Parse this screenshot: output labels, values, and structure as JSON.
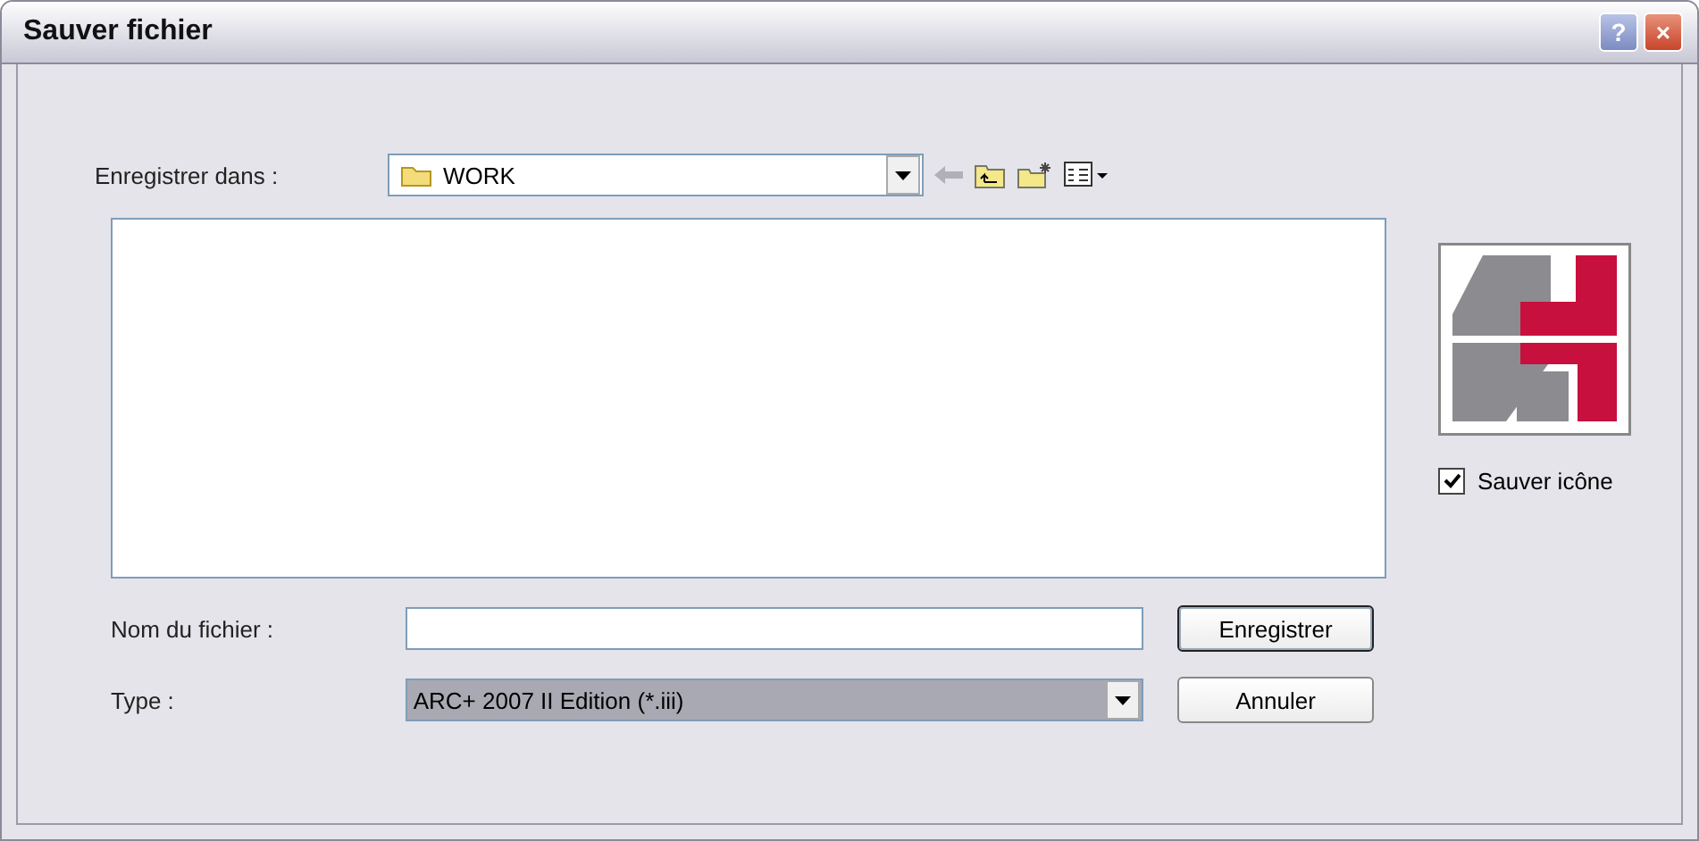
{
  "window": {
    "title": "Sauver fichier",
    "buttons": [
      "?",
      "×"
    ]
  },
  "save_in": {
    "label": "Enregistrer dans :",
    "value": "WORK"
  },
  "save_icon": {
    "label": "Sauver icône",
    "checked": true
  },
  "file_name": {
    "label": "Nom du fichier :"
  },
  "file_type": {
    "label": "Type :",
    "value": "ARC+ 2007 II Edition (*.iii)"
  },
  "buttons": [
    {
      "label": "Enregistrer",
      "default": true
    },
    {
      "label": "Annuler",
      "default": false
    }
  ]
}
